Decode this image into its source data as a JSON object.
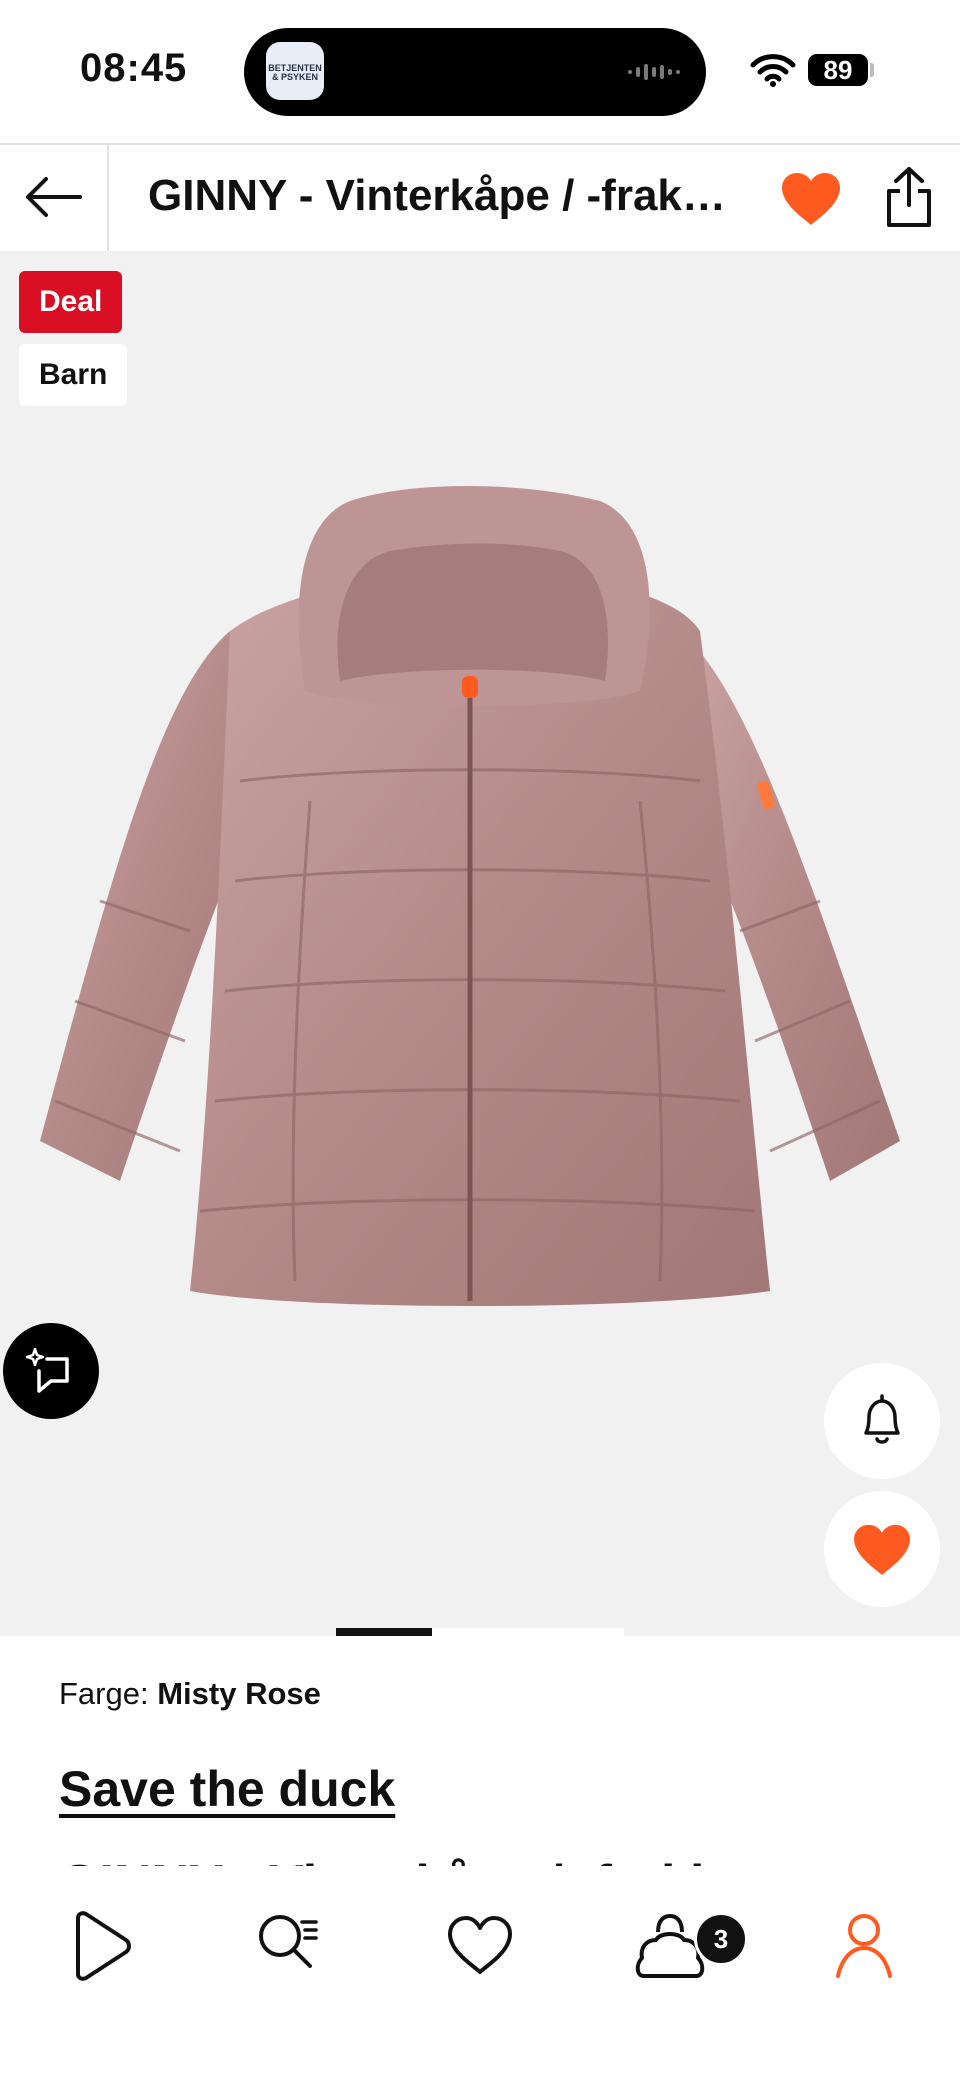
{
  "status_bar": {
    "time": "08:45",
    "battery": "89",
    "island_app_text": "BETJENTEN & PSYKEN"
  },
  "header": {
    "title": "GINNY - Vinterkåpe / -frakk - misty rose"
  },
  "badges": {
    "deal": "Deal",
    "barn": "Barn"
  },
  "product": {
    "color_label": "Farge:",
    "color_value": "Misty Rose",
    "brand": "Save the duck",
    "name": "GINNY - Vinterkåpe / -frakk",
    "image_index": 1,
    "image_count": 3
  },
  "bottom_nav": {
    "cart_count": "3"
  },
  "colors": {
    "accent": "#ff5a1f",
    "deal_red": "#d80f22",
    "jacket": "#b68d8c"
  }
}
